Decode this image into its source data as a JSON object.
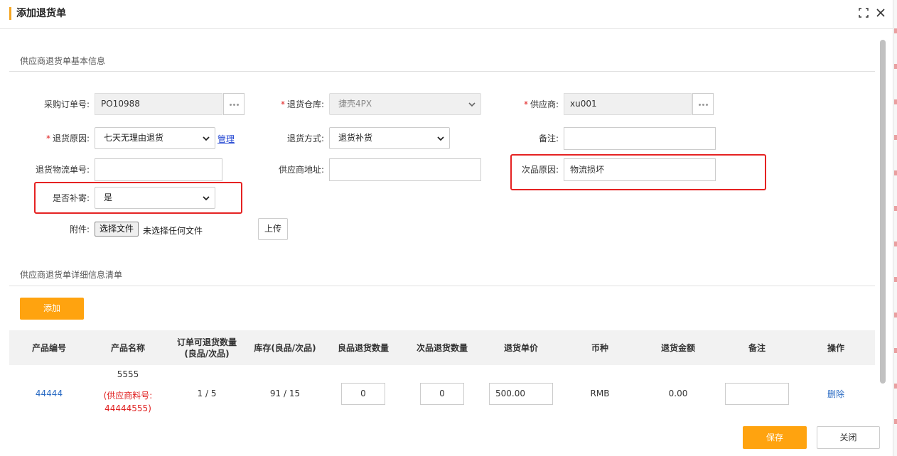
{
  "modal": {
    "title": "添加退货单"
  },
  "sections": {
    "basic": "供应商退货单基本信息",
    "detail": "供应商退货单详细信息清单"
  },
  "form": {
    "po_number": {
      "label": "采购订单号:",
      "value": "PO10988"
    },
    "warehouse": {
      "label": "退货仓库:",
      "value": "捷壳4PX"
    },
    "supplier": {
      "label": "供应商:",
      "value": "xu001"
    },
    "reason": {
      "label": "退货原因:",
      "value": "七天无理由退货",
      "manage_link": "管理"
    },
    "method": {
      "label": "退货方式:",
      "value": "退货补货"
    },
    "remark": {
      "label": "备注:",
      "value": ""
    },
    "tracking": {
      "label": "退货物流单号:",
      "value": ""
    },
    "address": {
      "label": "供应商地址:",
      "value": ""
    },
    "defect_reason": {
      "label": "次品原因:",
      "value": "物流损坏"
    },
    "reship": {
      "label": "是否补寄:",
      "value": "是"
    },
    "attachment": {
      "label": "附件:",
      "choose_label": "选择文件",
      "none_label": "未选择任何文件",
      "upload_label": "上传"
    }
  },
  "add_button": "添加",
  "table": {
    "headers": [
      "产品编号",
      "产品名称",
      "订单可退货数量(良品/次品)",
      "库存(良品/次品)",
      "良品退货数量",
      "次品退货数量",
      "退货单价",
      "币种",
      "退货金额",
      "备注",
      "操作"
    ],
    "header_line1_qty": "订单可退货数量",
    "header_line2_qty": "(良品/次品)",
    "rows": [
      {
        "code": "44444",
        "name": "5555",
        "supplier_sku": "(供应商料号:",
        "supplier_sku_cut": "44444555)",
        "returnable": "1 / 5",
        "stock": "91 / 15",
        "good_qty": "0",
        "defect_qty": "0",
        "unit_price": "500.00",
        "currency": "RMB",
        "amount": "0.00",
        "remark": "",
        "action": "删除"
      }
    ]
  },
  "footer": {
    "save": "保存",
    "close": "关闭"
  },
  "colors": {
    "accent": "#ffa30f",
    "highlight": "#e52222",
    "link": "#2b6cc4"
  }
}
